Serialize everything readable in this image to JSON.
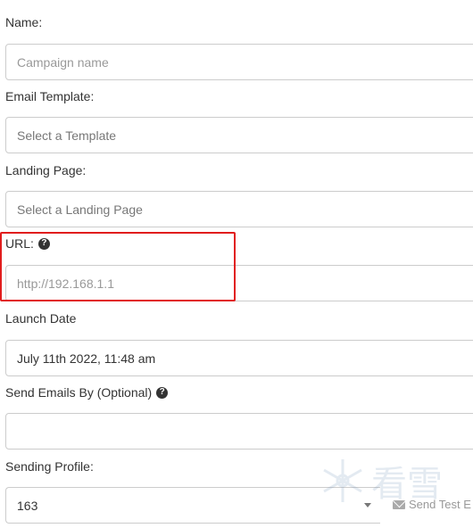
{
  "form": {
    "name": {
      "label": "Name:",
      "placeholder": "Campaign name"
    },
    "email_template": {
      "label": "Email Template:",
      "placeholder": "Select a Template"
    },
    "landing_page": {
      "label": "Landing Page:",
      "placeholder": "Select a Landing Page"
    },
    "url": {
      "label": "URL:",
      "placeholder": "http://192.168.1.1",
      "help_icon": "question-circle-icon"
    },
    "launch_date": {
      "label": "Launch Date",
      "value": "July 11th 2022, 11:48 am"
    },
    "send_by": {
      "label": "Send Emails By (Optional)",
      "value": "",
      "help_icon": "question-circle-icon"
    },
    "sending_profile": {
      "label": "Sending Profile:",
      "value": "163"
    },
    "send_test": {
      "label": "Send Test E",
      "icon": "envelope-icon"
    }
  },
  "highlight": {
    "color": "#e11d1d",
    "target": "url"
  },
  "watermark": {
    "text": "看雪",
    "icon": "snowflake-icon"
  }
}
